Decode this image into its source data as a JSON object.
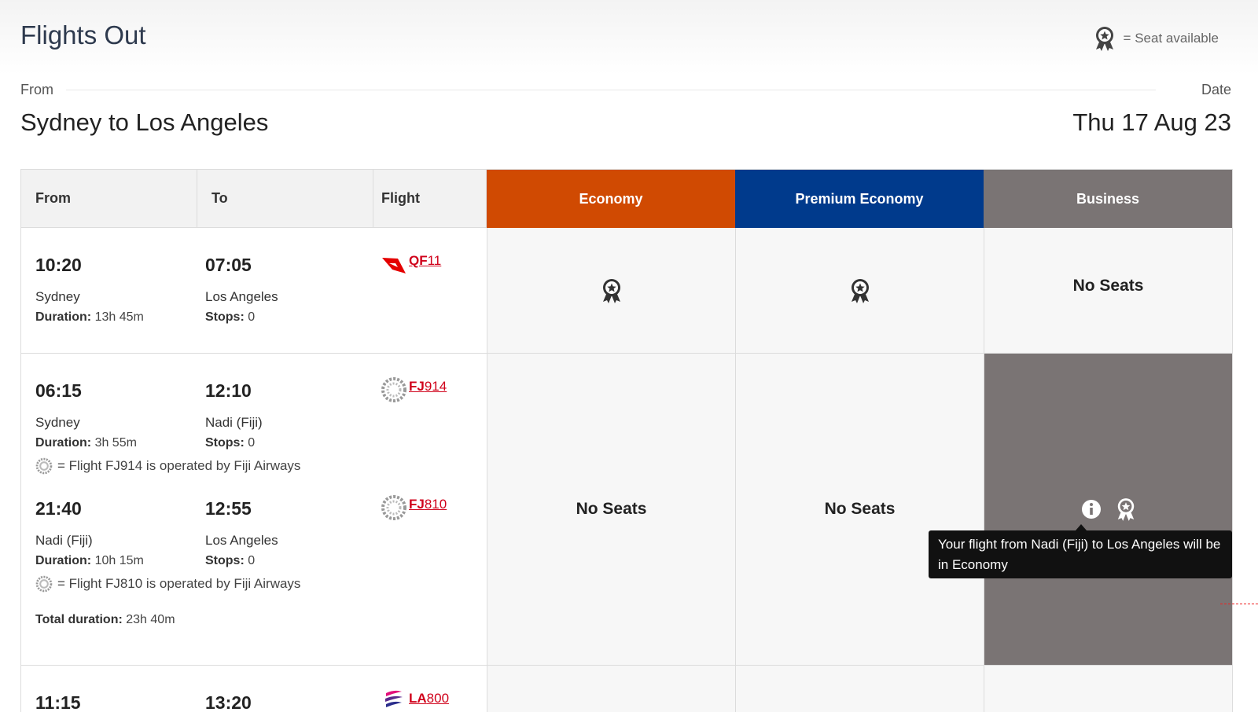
{
  "page": {
    "title": "Flights Out",
    "legend_text": "= Seat available",
    "from_label": "From",
    "date_label": "Date",
    "route": "Sydney to Los Angeles",
    "date": "Thu 17 Aug 23"
  },
  "colors": {
    "economy": "#d04a02",
    "premium_economy": "#003a8c",
    "business": "#7a7474",
    "flight_link": "#d0021b"
  },
  "table": {
    "headers": {
      "from": "From",
      "to": "To",
      "flight": "Flight",
      "economy": "Economy",
      "premium_economy": "Premium Economy",
      "business": "Business"
    },
    "rows": [
      {
        "segments": [
          {
            "dep_time": "10:20",
            "dep_city": "Sydney",
            "duration_label": "Duration:",
            "duration": "13h 45m",
            "arr_time": "07:05",
            "arr_city": "Los Angeles",
            "stops_label": "Stops:",
            "stops": "0",
            "airline_icon": "qantas-logo-icon",
            "flight_code": "QF",
            "flight_num": "11"
          }
        ],
        "economy": "seat-available-icon",
        "premium_economy": "seat-available-icon",
        "business": "No Seats"
      },
      {
        "segments": [
          {
            "dep_time": "06:15",
            "dep_city": "Sydney",
            "duration_label": "Duration:",
            "duration": "3h 55m",
            "arr_time": "12:10",
            "arr_city": "Nadi (Fiji)",
            "stops_label": "Stops:",
            "stops": "0",
            "airline_icon": "fiji-airways-logo-icon",
            "flight_code": "FJ",
            "flight_num": "914",
            "operated_note": "= Flight FJ914 is operated by Fiji Airways"
          },
          {
            "dep_time": "21:40",
            "dep_city": "Nadi (Fiji)",
            "duration_label": "Duration:",
            "duration": "10h 15m",
            "arr_time": "12:55",
            "arr_city": "Los Angeles",
            "stops_label": "Stops:",
            "stops": "0",
            "airline_icon": "fiji-airways-logo-icon",
            "flight_code": "FJ",
            "flight_num": "810",
            "operated_note": "= Flight FJ810 is operated by Fiji Airways"
          }
        ],
        "total_duration_label": "Total duration:",
        "total_duration": "23h 40m",
        "economy": "No Seats",
        "premium_economy": "No Seats",
        "business": "seat-available-icon"
      },
      {
        "segments": [
          {
            "dep_time": "11:15",
            "arr_time": "13:20",
            "airline_icon": "latam-logo-icon",
            "flight_code": "LA",
            "flight_num": "800"
          }
        ]
      }
    ]
  },
  "tooltip": {
    "text": "Your flight from Nadi (Fiji) to Los Angeles will be in Economy"
  }
}
